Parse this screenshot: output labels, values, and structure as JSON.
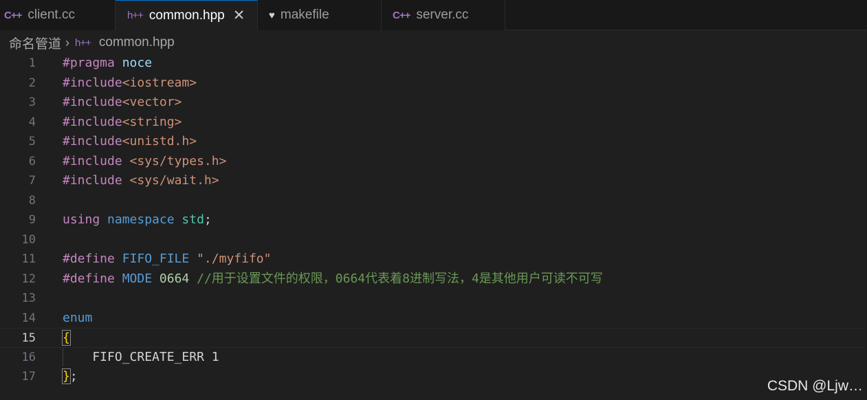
{
  "tabs": [
    {
      "icon": "C++",
      "label": "client.cc",
      "active": false
    },
    {
      "icon": "h++",
      "label": "common.hpp",
      "active": true,
      "close": "✕"
    },
    {
      "icon": "♥",
      "label": "makefile",
      "active": false
    },
    {
      "icon": "C++",
      "label": "server.cc",
      "active": false
    }
  ],
  "breadcrumb": {
    "folder": "命名管道",
    "sep": "›",
    "file_icon": "h++",
    "file": "common.hpp"
  },
  "current_line": 15,
  "code_lines": [
    {
      "n": "1",
      "t": [
        [
          "kw-pp",
          "#pragma"
        ],
        [
          "plain",
          " "
        ],
        [
          "ident",
          "noce"
        ]
      ]
    },
    {
      "n": "2",
      "t": [
        [
          "kw-pp",
          "#include"
        ],
        [
          "str",
          "<iostream>"
        ]
      ]
    },
    {
      "n": "3",
      "t": [
        [
          "kw-pp",
          "#include"
        ],
        [
          "str",
          "<vector>"
        ]
      ]
    },
    {
      "n": "4",
      "t": [
        [
          "kw-pp",
          "#include"
        ],
        [
          "str",
          "<string>"
        ]
      ]
    },
    {
      "n": "5",
      "t": [
        [
          "kw-pp",
          "#include"
        ],
        [
          "str",
          "<unistd.h>"
        ]
      ]
    },
    {
      "n": "6",
      "t": [
        [
          "kw-pp",
          "#include"
        ],
        [
          "plain",
          " "
        ],
        [
          "str",
          "<sys/types.h>"
        ]
      ]
    },
    {
      "n": "7",
      "t": [
        [
          "kw-pp",
          "#include"
        ],
        [
          "plain",
          " "
        ],
        [
          "str",
          "<sys/wait.h>"
        ]
      ]
    },
    {
      "n": "8",
      "t": []
    },
    {
      "n": "9",
      "t": [
        [
          "kw-pp",
          "using"
        ],
        [
          "plain",
          " "
        ],
        [
          "kw",
          "namespace"
        ],
        [
          "plain",
          " "
        ],
        [
          "ns",
          "std"
        ],
        [
          "plain",
          ";"
        ]
      ]
    },
    {
      "n": "10",
      "t": []
    },
    {
      "n": "11",
      "t": [
        [
          "kw-pp",
          "#define"
        ],
        [
          "plain",
          " "
        ],
        [
          "mac",
          "FIFO_FILE"
        ],
        [
          "plain",
          " "
        ],
        [
          "str",
          "\"./myfifo\""
        ]
      ]
    },
    {
      "n": "12",
      "t": [
        [
          "kw-pp",
          "#define"
        ],
        [
          "plain",
          " "
        ],
        [
          "mac",
          "MODE"
        ],
        [
          "plain",
          " "
        ],
        [
          "num",
          "0664"
        ],
        [
          "plain",
          " "
        ],
        [
          "cmt",
          "//用于设置文件的权限，0664代表着8进制写法，4是其他用户可读不可写"
        ]
      ]
    },
    {
      "n": "13",
      "t": []
    },
    {
      "n": "14",
      "t": [
        [
          "kw",
          "enum"
        ]
      ]
    },
    {
      "n": "15",
      "t": [
        [
          "brace match",
          "{"
        ]
      ]
    },
    {
      "n": "16",
      "t": [
        [
          "plain",
          "    FIFO_CREATE_ERR 1"
        ]
      ]
    },
    {
      "n": "17",
      "t": [
        [
          "brace match",
          "}"
        ],
        [
          "plain",
          ";"
        ]
      ]
    }
  ],
  "watermark": "CSDN @Ljw…"
}
